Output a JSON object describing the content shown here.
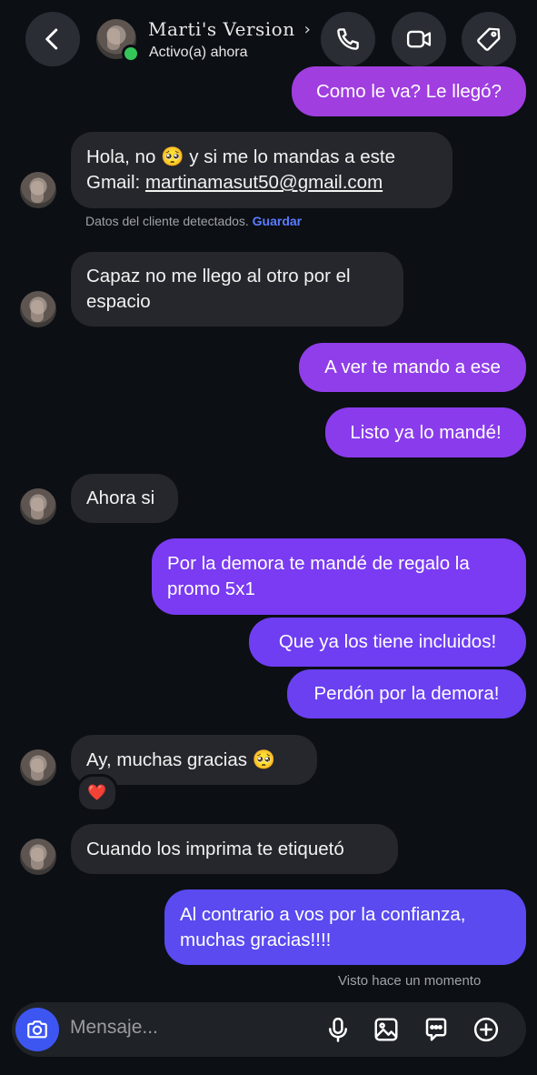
{
  "header": {
    "contact_name": "Marti's Version",
    "status": "Activo(a) ahora",
    "back_icon": "chevron-left-icon",
    "call_icon": "phone-icon",
    "video_icon": "video-camera-icon",
    "tag_icon": "tag-icon"
  },
  "messages": [
    {
      "dir": "out",
      "text": "Como le va? Le llegó?"
    },
    {
      "dir": "in",
      "line1": "Hola, no 🥺 y si me lo mandas a este",
      "line2_prefix": "Gmail: ",
      "email": "martinamasut50@gmail.com"
    },
    {
      "dir": "in",
      "line1": "Capaz no me llego al otro por el",
      "line2": "espacio"
    },
    {
      "dir": "out",
      "text": "A ver te mando a ese"
    },
    {
      "dir": "out",
      "text": "Listo ya lo mandé!"
    },
    {
      "dir": "in",
      "text": "Ahora si"
    },
    {
      "dir": "out",
      "line1": "Por la demora te mandé de regalo la",
      "line2": "promo 5x1"
    },
    {
      "dir": "out",
      "text": "Que ya los tiene incluidos!"
    },
    {
      "dir": "out",
      "text": "Perdón por la demora!"
    },
    {
      "dir": "in",
      "text": "Ay, muchas gracias 🥺",
      "reaction": "❤️"
    },
    {
      "dir": "in",
      "text": "Cuando los imprima te etiquetó"
    },
    {
      "dir": "out",
      "line1": "Al contrario a vos por la confianza,",
      "line2": "muchas gracias!!!!"
    }
  ],
  "client_detected": {
    "text": "Datos del cliente detectados.",
    "action": "Guardar"
  },
  "seen_status": "Visto hace un momento",
  "composer": {
    "placeholder": "Mensaje...",
    "camera_icon": "camera-icon",
    "mic_icon": "microphone-icon",
    "gallery_icon": "image-icon",
    "sticker_icon": "chat-sticker-icon",
    "add_icon": "plus-circle-icon"
  },
  "colors": {
    "background": "#0c0f14",
    "incoming_bubble": "#25272c",
    "outgoing_magenta": "#a03ee0",
    "outgoing_purple": "#7a3bf2",
    "outgoing_blue": "#5a4af0",
    "accent_blue": "#3d56f2",
    "link_blue": "#5b7cff",
    "online_green": "#35c65a"
  }
}
